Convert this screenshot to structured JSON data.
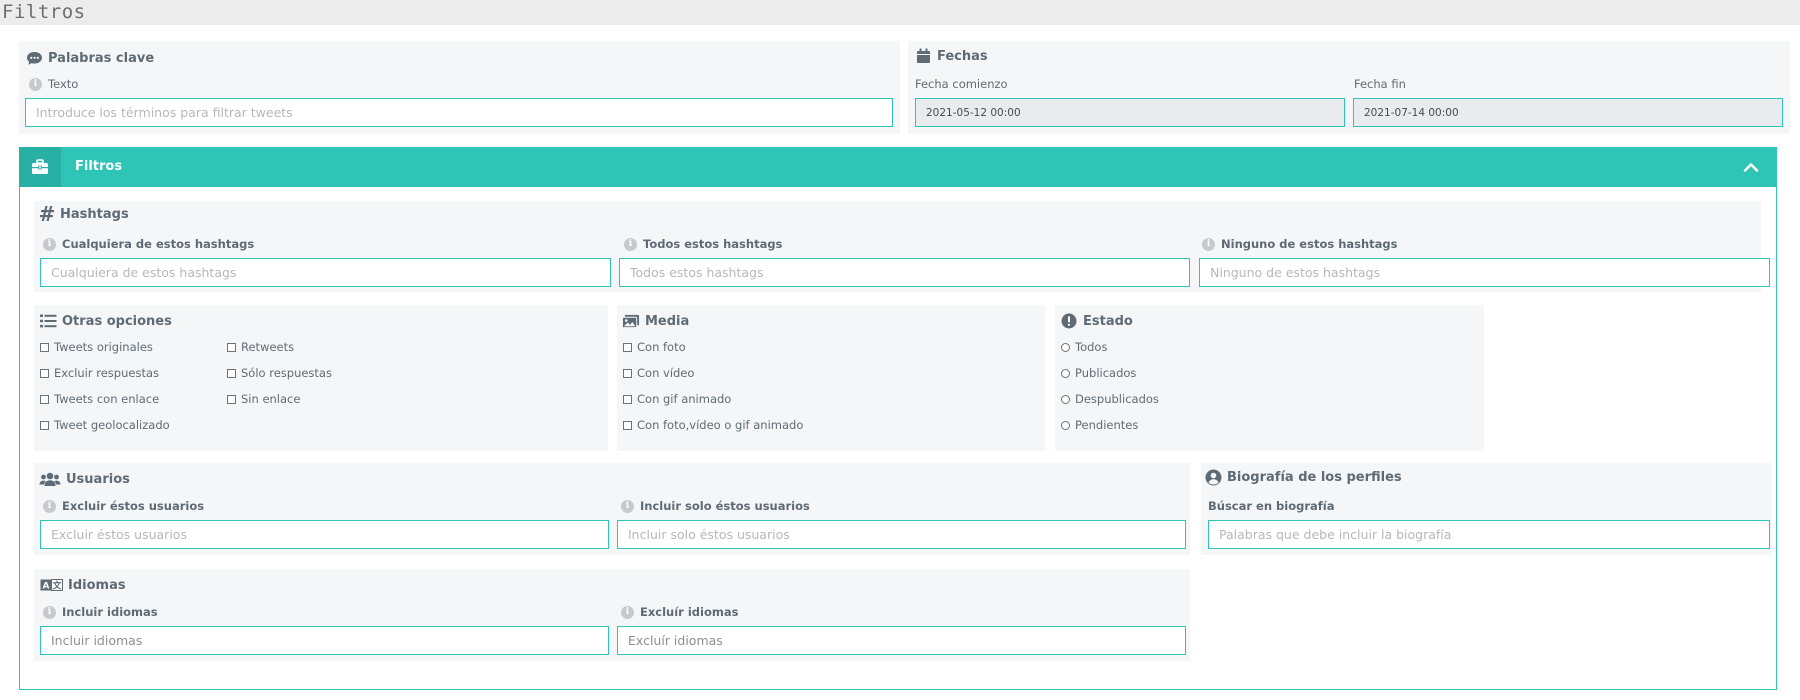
{
  "page": {
    "title": "Filtros"
  },
  "keywords": {
    "title": "Palabras clave",
    "icon": "comment-dots-icon",
    "text_label": "Texto",
    "text_placeholder": "Introduce los términos para filtrar tweets"
  },
  "dates": {
    "title": "Fechas",
    "icon": "calendar-icon",
    "start_label": "Fecha comienzo",
    "start_value": "2021-05-12 00:00",
    "end_label": "Fecha fin",
    "end_value": "2021-07-14 00:00"
  },
  "filters": {
    "header_title": "Filtros",
    "header_icon": "briefcase-icon",
    "accent_color": "#2ec4b6",
    "hashtags": {
      "title": "Hashtags",
      "any_label": "Cualquiera de estos hashtags",
      "any_placeholder": "Cualquiera de estos hashtags",
      "all_label": "Todos estos hashtags",
      "all_placeholder": "Todos estos hashtags",
      "none_label": "Ninguno de estos hashtags",
      "none_placeholder": "Ninguno de estos hashtags"
    },
    "other_options": {
      "title": "Otras opciones",
      "options": [
        "Tweets originales",
        "Excluir respuestas",
        "Tweets con enlace",
        "Tweet geolocalizado",
        "Retweets",
        "Sólo respuestas",
        "Sin enlace"
      ]
    },
    "media": {
      "title": "Media",
      "options": [
        "Con foto",
        "Con vídeo",
        "Con gif animado",
        "Con foto,vídeo o gif animado"
      ]
    },
    "status": {
      "title": "Estado",
      "options": [
        "Todos",
        "Publicados",
        "Despublicados",
        "Pendientes"
      ]
    },
    "users": {
      "title": "Usuarios",
      "exclude_label": "Excluir éstos usuarios",
      "exclude_placeholder": "Excluir éstos usuarios",
      "include_label": "Incluir solo éstos usuarios",
      "include_placeholder": "Incluir solo éstos usuarios"
    },
    "bio": {
      "title": "Biografía de los perfiles",
      "search_label": "Búscar en biografía",
      "search_placeholder": "Palabras que debe incluir la biografía"
    },
    "languages": {
      "title": "Idiomas",
      "include_label": "Incluir idiomas",
      "include_placeholder": "Incluir idiomas",
      "exclude_label": "Excluír idiomas",
      "exclude_placeholder": "Excluír idiomas"
    }
  }
}
